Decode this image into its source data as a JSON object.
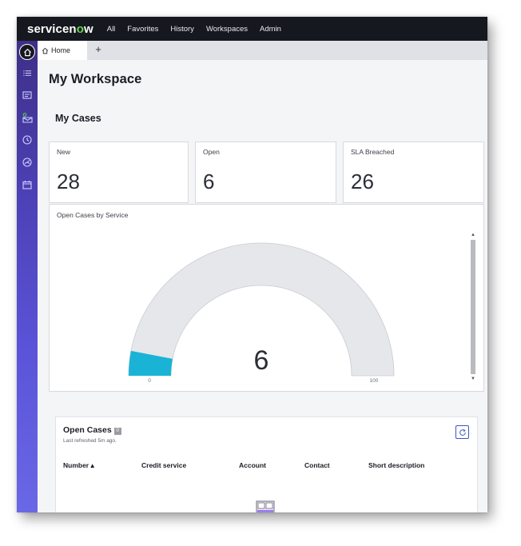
{
  "brand": {
    "name_prefix": "servicen",
    "name_o": "o",
    "name_suffix": "w",
    "logo_accent": "#62d84e"
  },
  "topnav": {
    "items": [
      "All",
      "Favorites",
      "History",
      "Workspaces",
      "Admin"
    ]
  },
  "rail": {
    "icons": [
      "home-icon",
      "list-icon",
      "form-icon",
      "inbox-icon",
      "clock-icon",
      "dashboard-icon",
      "calendar-icon"
    ]
  },
  "tabs": {
    "active_label": "Home",
    "new_tab_label": "+"
  },
  "page": {
    "title": "My Workspace",
    "section_title": "My Cases"
  },
  "cards": [
    {
      "label": "New",
      "value": "28"
    },
    {
      "label": "Open",
      "value": "6"
    },
    {
      "label": "SLA Breached",
      "value": "26"
    }
  ],
  "gauge": {
    "title": "Open Cases by Service",
    "value": 6,
    "value_label": "6",
    "min_label": "0",
    "max_label": "100",
    "min": 0,
    "max": 100,
    "fill_color": "#1ab3d6",
    "track_color": "#e6e7ea"
  },
  "open_cases": {
    "title": "Open Cases",
    "badge": "0",
    "refreshed": "Last refreshed 5m ago.",
    "columns": [
      "Number ▴",
      "Credit service",
      "Account",
      "Contact",
      "Short description"
    ]
  },
  "colors": {
    "topnav_bg": "#16181f",
    "rail_top": "#3d2f86",
    "rail_bottom": "#6a68e6",
    "accent_blue": "#3b55c8"
  }
}
